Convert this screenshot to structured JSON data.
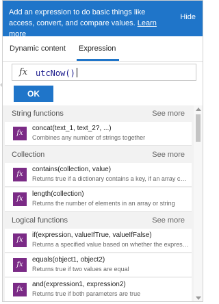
{
  "info": {
    "text": "Add an expression to do basic things like access, convert, and compare values.",
    "learn_more": "Learn more",
    "hide": "Hide",
    "background_color": "#1f75c9"
  },
  "tabs": [
    {
      "label": "Dynamic content",
      "active": false
    },
    {
      "label": "Expression",
      "active": true
    }
  ],
  "expression": {
    "fx": "fx",
    "value": "utcNow()"
  },
  "ok_button": "OK",
  "sections": [
    {
      "title": "String functions",
      "see_more": "See more",
      "items": [
        {
          "title": "concat(text_1, text_2?, ...)",
          "desc": "Combines any number of strings together"
        }
      ]
    },
    {
      "title": "Collection",
      "see_more": "See more",
      "items": [
        {
          "title": "contains(collection, value)",
          "desc": "Returns true if a dictionary contains a key, if an array cont..."
        },
        {
          "title": "length(collection)",
          "desc": "Returns the number of elements in an array or string"
        }
      ]
    },
    {
      "title": "Logical functions",
      "see_more": "See more",
      "items": [
        {
          "title": "if(expression, valueIfTrue, valueIfFalse)",
          "desc": "Returns a specified value based on whether the expression..."
        },
        {
          "title": "equals(object1, object2)",
          "desc": "Returns true if two values are equal"
        },
        {
          "title": "and(expression1, expression2)",
          "desc": "Returns true if both parameters are true"
        }
      ]
    }
  ],
  "icon_names": {
    "function": "function-icon"
  }
}
